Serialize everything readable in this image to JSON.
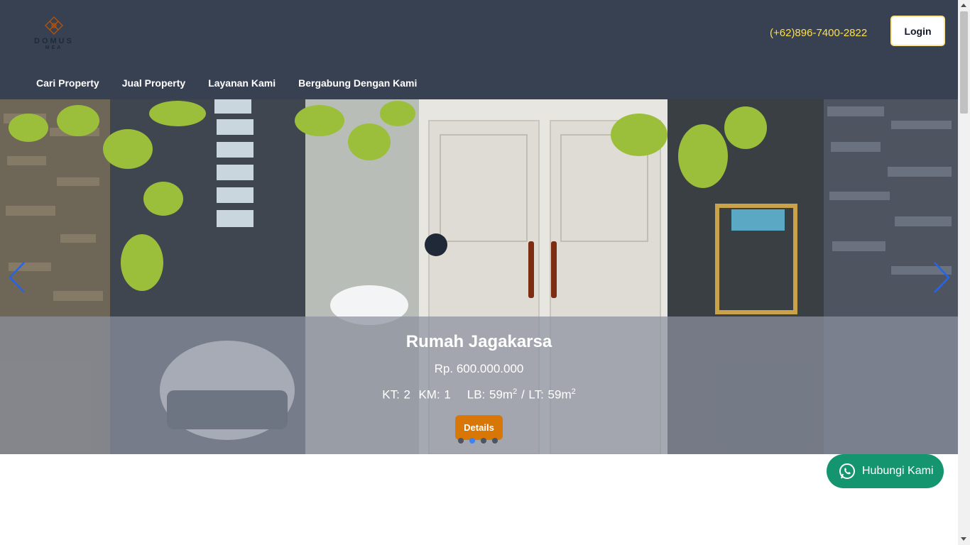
{
  "header": {
    "logo": {
      "name": "DOMUS",
      "sub": "MEA",
      "icon": "ornament-logo-icon"
    },
    "phone": "(+62)896-7400-2822",
    "login_label": "Login",
    "colors": {
      "background": "#374151",
      "phone": "#fde047"
    }
  },
  "nav": {
    "items": [
      {
        "label": "Cari Property"
      },
      {
        "label": "Jual Property"
      },
      {
        "label": "Layanan Kami"
      },
      {
        "label": "Bergabung Dengan Kami"
      }
    ]
  },
  "slider": {
    "title": "Rumah Jagakarsa",
    "price": "Rp. 600.000.000",
    "specs": {
      "kt": "KT: 2",
      "km": "KM: 1",
      "lb": "LB: 59m",
      "lt": "LT: 59m",
      "exp": "2",
      "sep": "/"
    },
    "details_label": "Details",
    "dot_count": 4,
    "active_dot": 1,
    "prev_icon": "chevron-left-icon",
    "next_icon": "chevron-right-icon",
    "accent": "#d97706"
  },
  "whatsapp": {
    "label": "Hubungi Kami",
    "icon": "whatsapp-icon",
    "color": "#15956f"
  }
}
